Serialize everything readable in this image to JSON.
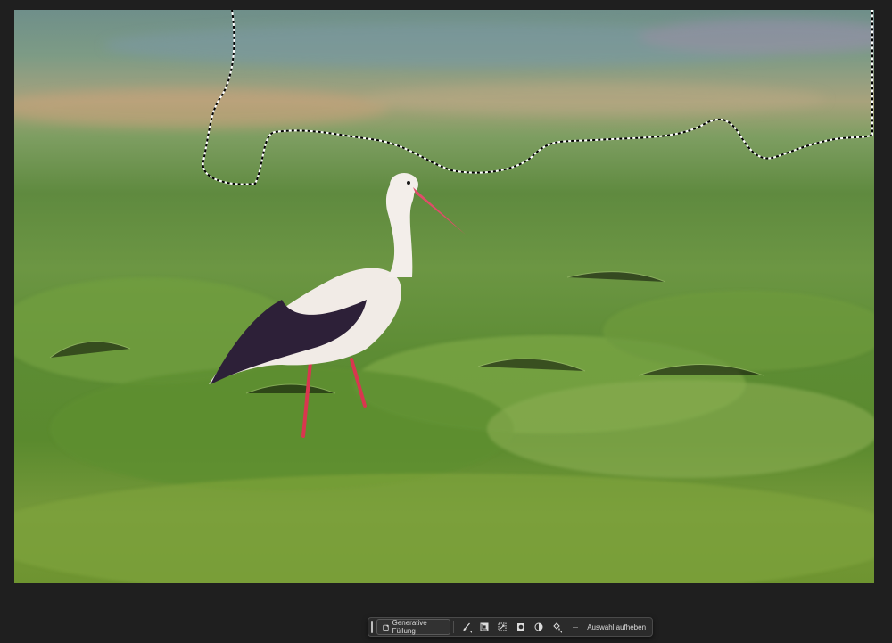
{
  "taskbar": {
    "generative_fill_label": "Generative Füllung",
    "more_label": "···",
    "deselect_label": "Auswahl aufheben"
  },
  "icons": {
    "generative_fill": "generative-fill-icon",
    "brush": "brush-icon",
    "invert": "invert-selection-icon",
    "transform": "transform-icon",
    "mask": "mask-icon",
    "adjust": "adjustment-icon",
    "fill": "fill-icon"
  },
  "colors": {
    "app_bg": "#1f1f1f",
    "taskbar_bg": "#2b2b2b",
    "taskbar_text": "#dcdcdc"
  }
}
